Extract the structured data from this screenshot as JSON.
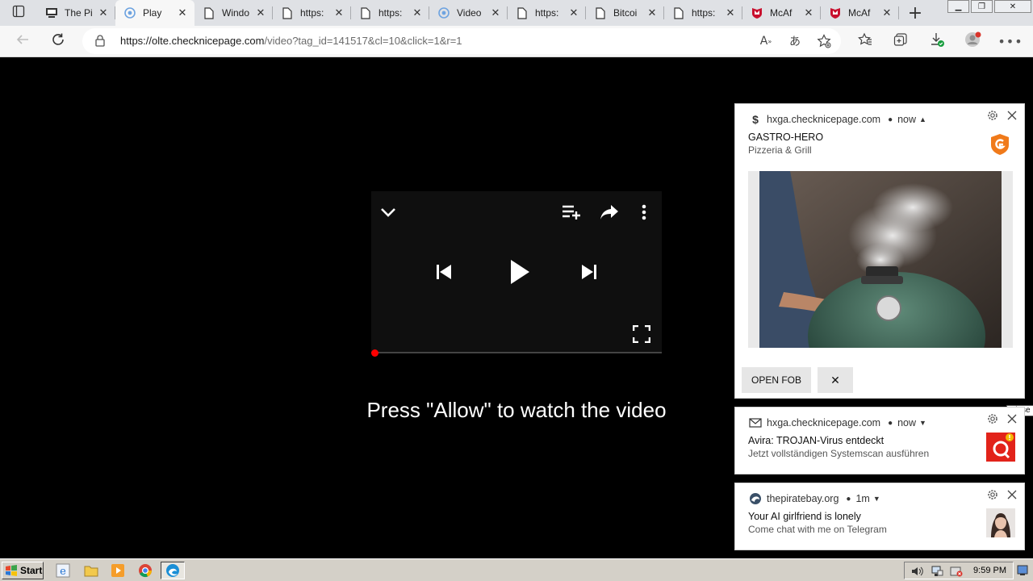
{
  "browser": {
    "tabs": [
      {
        "label": "The Pi",
        "icon": "monitor-icon",
        "active": false
      },
      {
        "label": "Play",
        "icon": "edge-icon",
        "active": true
      },
      {
        "label": "Windo",
        "icon": "page-icon",
        "active": false
      },
      {
        "label": "https:",
        "icon": "page-icon",
        "active": false
      },
      {
        "label": "https:",
        "icon": "page-icon",
        "active": false
      },
      {
        "label": "Video",
        "icon": "edge-icon",
        "active": false
      },
      {
        "label": "https:",
        "icon": "page-icon",
        "active": false
      },
      {
        "label": "Bitcoi",
        "icon": "page-icon",
        "active": false
      },
      {
        "label": "https:",
        "icon": "page-icon",
        "active": false
      },
      {
        "label": "McAf",
        "icon": "mcafee-icon",
        "active": false
      },
      {
        "label": "McAf",
        "icon": "mcafee-icon",
        "active": false
      }
    ],
    "url_host": "https://olte.checknicepage.com",
    "url_path": "/video?tag_id=141517&cl=10&click=1&r=1"
  },
  "player": {
    "progress": 0
  },
  "page": {
    "prompt": "Press \"Allow\" to watch the video"
  },
  "notifications": [
    {
      "source": "hxga.checknicepage.com",
      "time": "now",
      "title": "GASTRO-HERO",
      "body": "Pizzeria & Grill",
      "button_label": "OPEN FOB",
      "dismiss_label": "✕"
    },
    {
      "source": "hxga.checknicepage.com",
      "time": "now",
      "title": "Avira: TROJAN-Virus entdeckt",
      "body": "Jetzt vollständigen Systemscan ausführen"
    },
    {
      "source": "thepiratebay.org",
      "time": "1m",
      "title": "Your AI girlfriend is lonely",
      "body": "Come chat with me on Telegram"
    }
  ],
  "tooltip": "Close",
  "taskbar": {
    "start_label": "Start",
    "clock": "9:59 PM"
  },
  "colors": {
    "progress_accent": "#ff0000",
    "avira_red": "#e2231a",
    "gastro_orange": "#f07a1a"
  }
}
